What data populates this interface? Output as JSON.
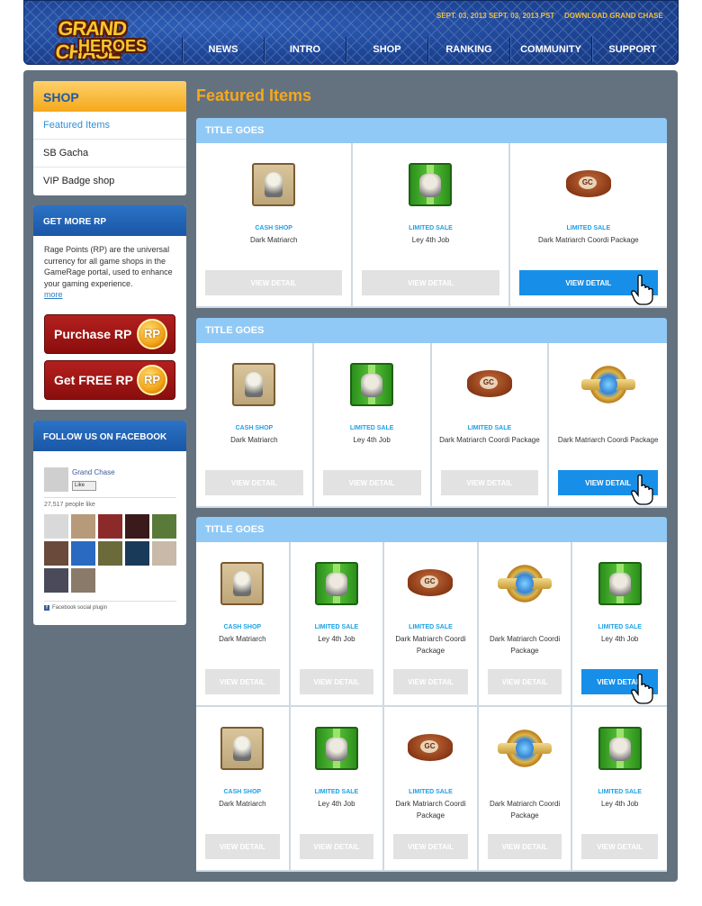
{
  "header": {
    "logo_top": "GRAND CHASE",
    "logo_bottom": "HEROES",
    "date": "SEPT. 03, 2013 SEPT. 03, 2013  PST",
    "download": "DOWNLOAD GRAND CHASE",
    "nav": [
      "NEWS",
      "INTRO",
      "SHOP",
      "RANKING",
      "COMMUNITY",
      "SUPPORT"
    ]
  },
  "sidebar": {
    "shop": {
      "title": "SHOP",
      "items": [
        "Featured Items",
        "SB Gacha",
        "VIP Badge shop"
      ]
    },
    "rp": {
      "title": "GET MORE RP",
      "text": "Rage Points (RP) are the universal currency for all game shops in the GameRage portal, used to enhance your gaming experience.",
      "more": "more",
      "purchase": "Purchase RP",
      "free": "Get FREE RP",
      "coin": "RP"
    },
    "facebook": {
      "title": "FOLLOW US ON FACEBOOK",
      "page_name": "Grand Chase",
      "like": "Like",
      "count": "27,517 people like",
      "plugin": "Facebook social plugin"
    }
  },
  "main": {
    "title": "Featured Items",
    "section_title": "TITLE GOES",
    "view_detail": "VIEW DETAIL",
    "items": {
      "cashshop": {
        "cat": "CASH SHOP",
        "name": "Dark Matriarch",
        "icon": "scroll-icon"
      },
      "ley": {
        "cat": "LIMITED SALE",
        "name": "Ley 4th Job",
        "icon": "gift-box-icon"
      },
      "package": {
        "cat": "LIMITED SALE",
        "name": "Dark Matriarch Coordi Package",
        "icon": "gc-ball-icon"
      },
      "badge": {
        "cat": "",
        "name": "Dark Matriarch Coordi Package",
        "icon": "badge-icon"
      }
    },
    "sections": [
      {
        "rows": [
          [
            "cashshop",
            "ley",
            "package"
          ]
        ],
        "active": [
          0,
          2
        ]
      },
      {
        "rows": [
          [
            "cashshop",
            "ley",
            "package",
            "badge"
          ]
        ],
        "active": [
          0,
          3
        ]
      },
      {
        "rows": [
          [
            "cashshop",
            "ley",
            "package",
            "badge",
            "ley"
          ],
          [
            "cashshop",
            "ley",
            "package",
            "badge",
            "ley"
          ]
        ],
        "active": [
          0,
          4
        ]
      }
    ]
  },
  "colors": {
    "accent": "#f5a81b",
    "active_button": "#178fe8",
    "section_header": "#90c9f5",
    "frame": "#64727f",
    "category_text": "#1da1e6"
  }
}
